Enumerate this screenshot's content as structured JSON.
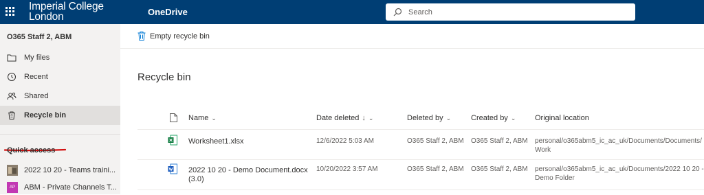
{
  "topbar": {
    "org_line1": "Imperial College",
    "org_line2": "London",
    "app_name": "OneDrive",
    "search_placeholder": "Search",
    "bg_color": "#003e74"
  },
  "sidebar": {
    "account_name": "O365 Staff 2, ABM",
    "items": [
      {
        "label": "My files",
        "icon": "folder-icon"
      },
      {
        "label": "Recent",
        "icon": "clock-icon"
      },
      {
        "label": "Shared",
        "icon": "people-icon"
      },
      {
        "label": "Recycle bin",
        "icon": "recycle-bin-icon",
        "selected": true
      }
    ],
    "quick_access_title": "Quick access",
    "quick_access": [
      {
        "label": "2022 10 20 - Teams traini..."
      },
      {
        "label": "ABM - Private Channels T...",
        "badge": "AP"
      }
    ]
  },
  "commandbar": {
    "empty_label": "Empty recycle bin"
  },
  "page": {
    "title": "Recycle bin"
  },
  "columns": {
    "name": "Name",
    "date_deleted": "Date deleted",
    "deleted_by": "Deleted by",
    "created_by": "Created by",
    "original_location": "Original location"
  },
  "rows": [
    {
      "name": "Worksheet1.xlsx",
      "type": "excel",
      "date_deleted": "12/6/2022 5:03 AM",
      "deleted_by": "O365 Staff 2, ABM",
      "created_by": "O365 Staff 2, ABM",
      "location_line1": "personal/o365abm5_ic_ac_uk/Documents/Documents/",
      "location_line2": "Work"
    },
    {
      "name": "2022 10 20 - Demo Document.docx",
      "name_line2": "(3.0)",
      "type": "word",
      "date_deleted": "10/20/2022 3:57 AM",
      "deleted_by": "O365 Staff 2, ABM",
      "created_by": "O365 Staff 2, ABM",
      "location_line1": "personal/o365abm5_ic_ac_uk/Documents/2022 10 20 -",
      "location_line2": "Demo Folder"
    }
  ]
}
